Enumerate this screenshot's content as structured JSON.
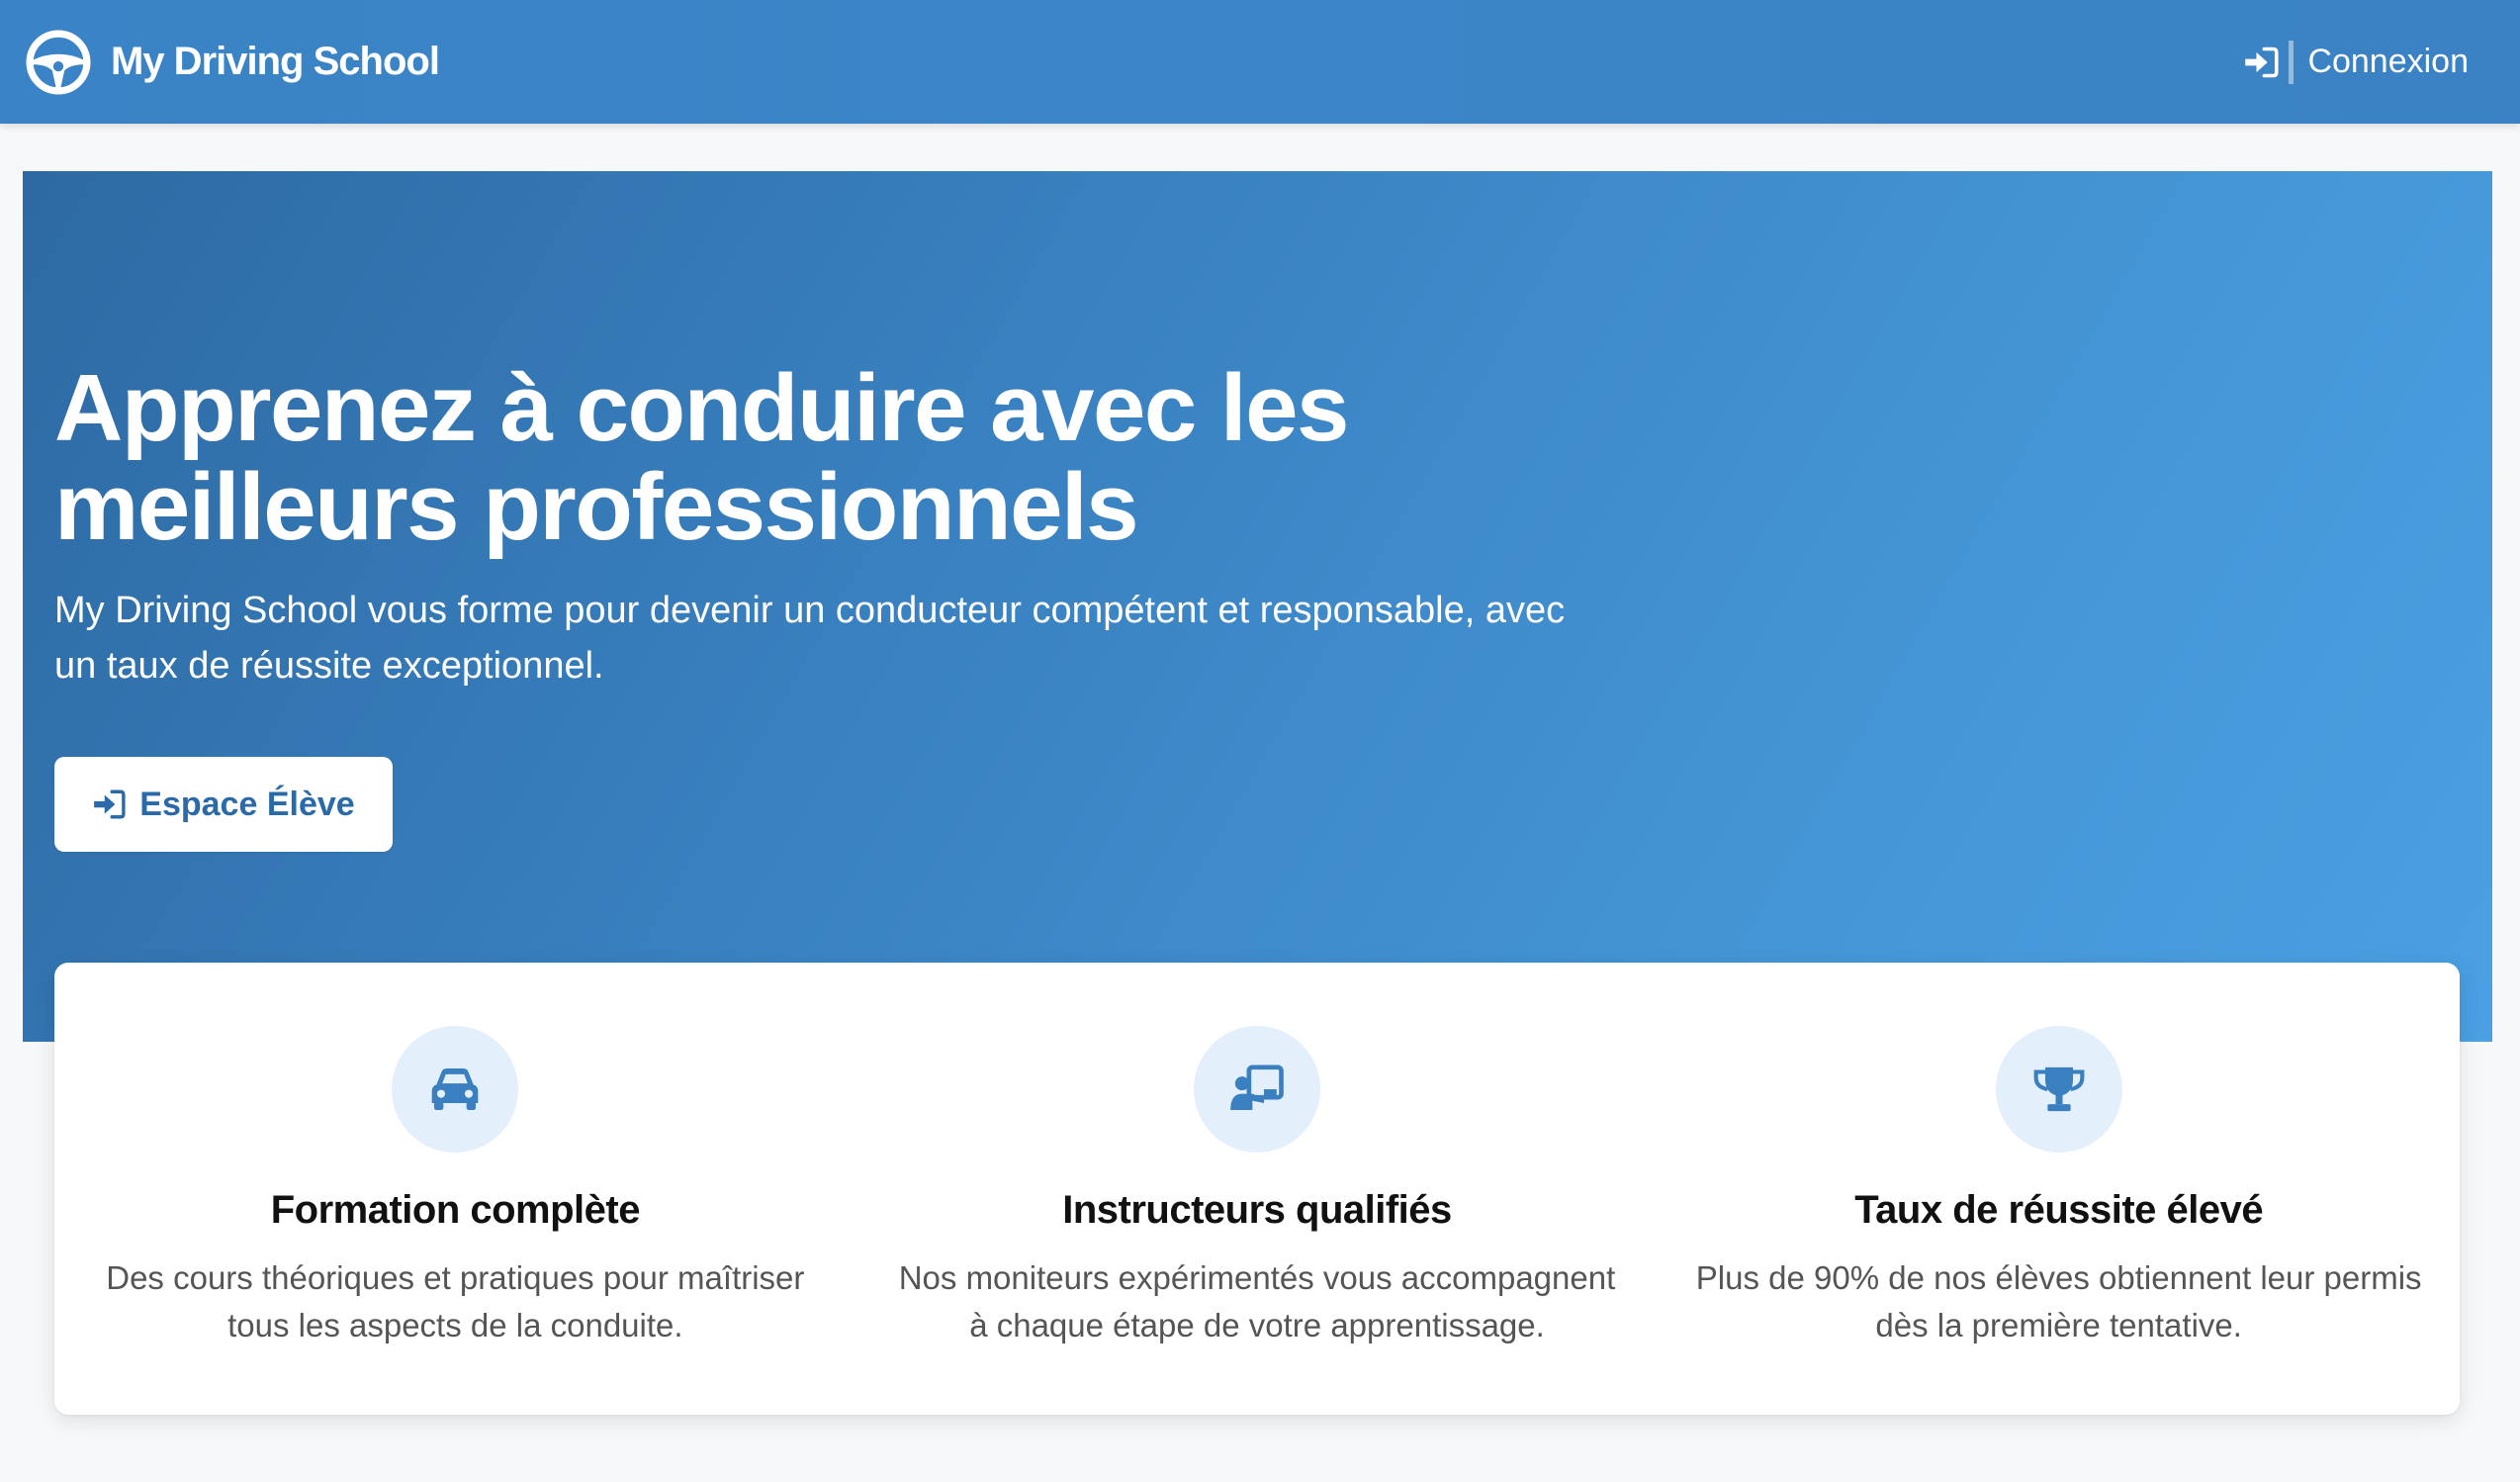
{
  "navbar": {
    "brand": "My Driving School",
    "brand_icon": "steering-wheel-icon",
    "login_label": "Connexion",
    "login_icon": "sign-in-icon"
  },
  "hero": {
    "title": "Apprenez à conduire avec les meilleurs professionnels",
    "subtitle": "My Driving School vous forme pour devenir un conducteur compétent et responsable, avec un taux de réussite exceptionnel.",
    "cta_label": "Espace Élève",
    "cta_icon": "sign-in-icon"
  },
  "features": [
    {
      "icon": "car-icon",
      "title": "Formation complète",
      "description": "Des cours théoriques et pratiques pour maîtriser tous les aspects de la conduite."
    },
    {
      "icon": "chalkboard-teacher-icon",
      "title": "Instructeurs qualifiés",
      "description": "Nos moniteurs expérimentés vous accompagnent à chaque étape de votre apprentissage."
    },
    {
      "icon": "trophy-icon",
      "title": "Taux de réussite élevé",
      "description": "Plus de 90% de nos élèves obtiennent leur permis dès la première tentative."
    }
  ],
  "colors": {
    "primary": "#3a83c6",
    "hero_start": "#2d6aa3",
    "hero_end": "#4aa0e2",
    "icon_bg": "#e3effb",
    "icon_fg": "#3a7fc0"
  }
}
